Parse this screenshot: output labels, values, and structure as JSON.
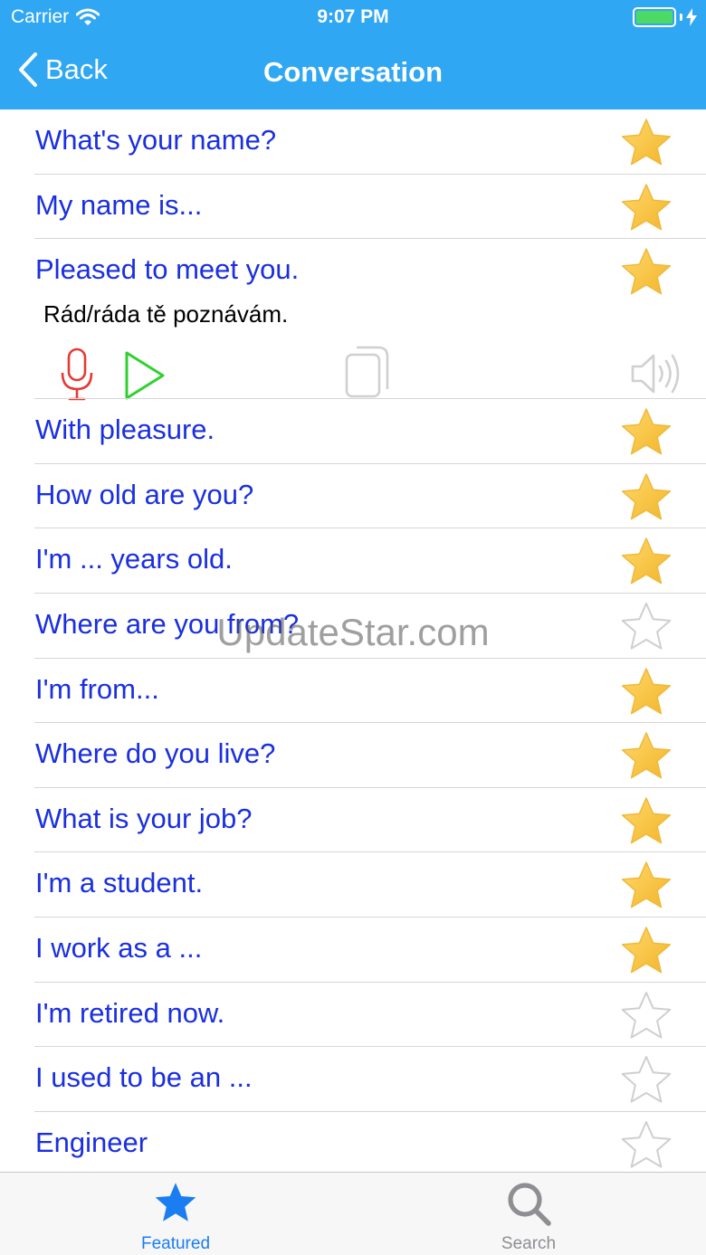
{
  "status_bar": {
    "carrier": "Carrier",
    "time": "9:07 PM"
  },
  "nav": {
    "back_label": "Back",
    "title": "Conversation"
  },
  "rows": [
    {
      "text": "What's your name?",
      "favorite": true
    },
    {
      "text": "My name is...",
      "favorite": true
    },
    {
      "text": "Pleased to meet you.",
      "favorite": true,
      "translation": "Rád/ráda tě poznávám."
    },
    {
      "text": "With pleasure.",
      "favorite": true
    },
    {
      "text": "How old are you?",
      "favorite": true
    },
    {
      "text": "I'm ... years old.",
      "favorite": true
    },
    {
      "text": "Where are you from?",
      "favorite": false
    },
    {
      "text": "I'm from...",
      "favorite": true
    },
    {
      "text": "Where do you live?",
      "favorite": true
    },
    {
      "text": "What is your job?",
      "favorite": true
    },
    {
      "text": "I'm a student.",
      "favorite": true
    },
    {
      "text": "I work as a ...",
      "favorite": true
    },
    {
      "text": "I'm retired now.",
      "favorite": false
    },
    {
      "text": "I used to be an ...",
      "favorite": false
    },
    {
      "text": "Engineer",
      "favorite": false
    }
  ],
  "tools": {
    "mic_icon": "microphone-icon",
    "play_icon": "play-icon",
    "copy_icon": "copy-icon",
    "speaker_icon": "speaker-icon"
  },
  "watermark": "UpdateStar.com",
  "tabs": [
    {
      "label": "Featured",
      "icon": "star-icon",
      "active": true
    },
    {
      "label": "Search",
      "icon": "search-icon",
      "active": false
    }
  ],
  "colors": {
    "bar": "#2fa7f3",
    "phrase": "#1a2fe0",
    "star": "#f7c93c",
    "tab_active": "#1a7df2",
    "tab_inactive": "#8e8e93"
  }
}
